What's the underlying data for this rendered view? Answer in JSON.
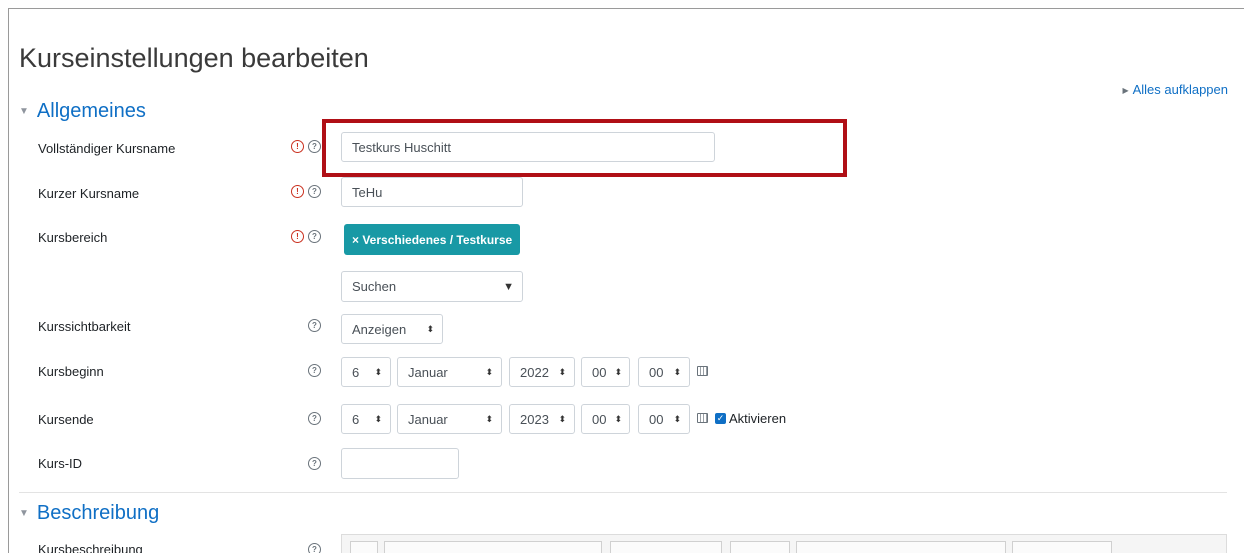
{
  "page": {
    "title": "Kurseinstellungen bearbeiten",
    "expand_all": "Alles aufklappen"
  },
  "sections": {
    "general": {
      "title": "Allgemeines"
    },
    "description": {
      "title": "Beschreibung"
    }
  },
  "fields": {
    "fullname": {
      "label": "Vollständiger Kursname",
      "value": "Testkurs Huschitt"
    },
    "shortname": {
      "label": "Kurzer Kursname",
      "value": "TeHu"
    },
    "category": {
      "label": "Kursbereich",
      "selected": "× Verschiedenes / Testkurse",
      "search_placeholder": "Suchen"
    },
    "visibility": {
      "label": "Kurssichtbarkeit",
      "value": "Anzeigen"
    },
    "startdate": {
      "label": "Kursbeginn",
      "day": "6",
      "month": "Januar",
      "year": "2022",
      "hour": "00",
      "minute": "00"
    },
    "enddate": {
      "label": "Kursende",
      "day": "6",
      "month": "Januar",
      "year": "2023",
      "hour": "00",
      "minute": "00",
      "enable_label": "Aktivieren",
      "enabled": true
    },
    "idnumber": {
      "label": "Kurs-ID",
      "value": ""
    },
    "summary": {
      "label": "Kursbeschreibung"
    }
  },
  "icons": {
    "required": "exclamation-circle-icon",
    "help": "question-circle-icon",
    "calendar": "calendar-icon",
    "collapse": "caret-down-icon",
    "expand": "caret-right-icon"
  },
  "colors": {
    "link": "#0f6fc5",
    "badge": "#1899a5",
    "highlight": "#b00f16",
    "required": "#ca3120"
  }
}
